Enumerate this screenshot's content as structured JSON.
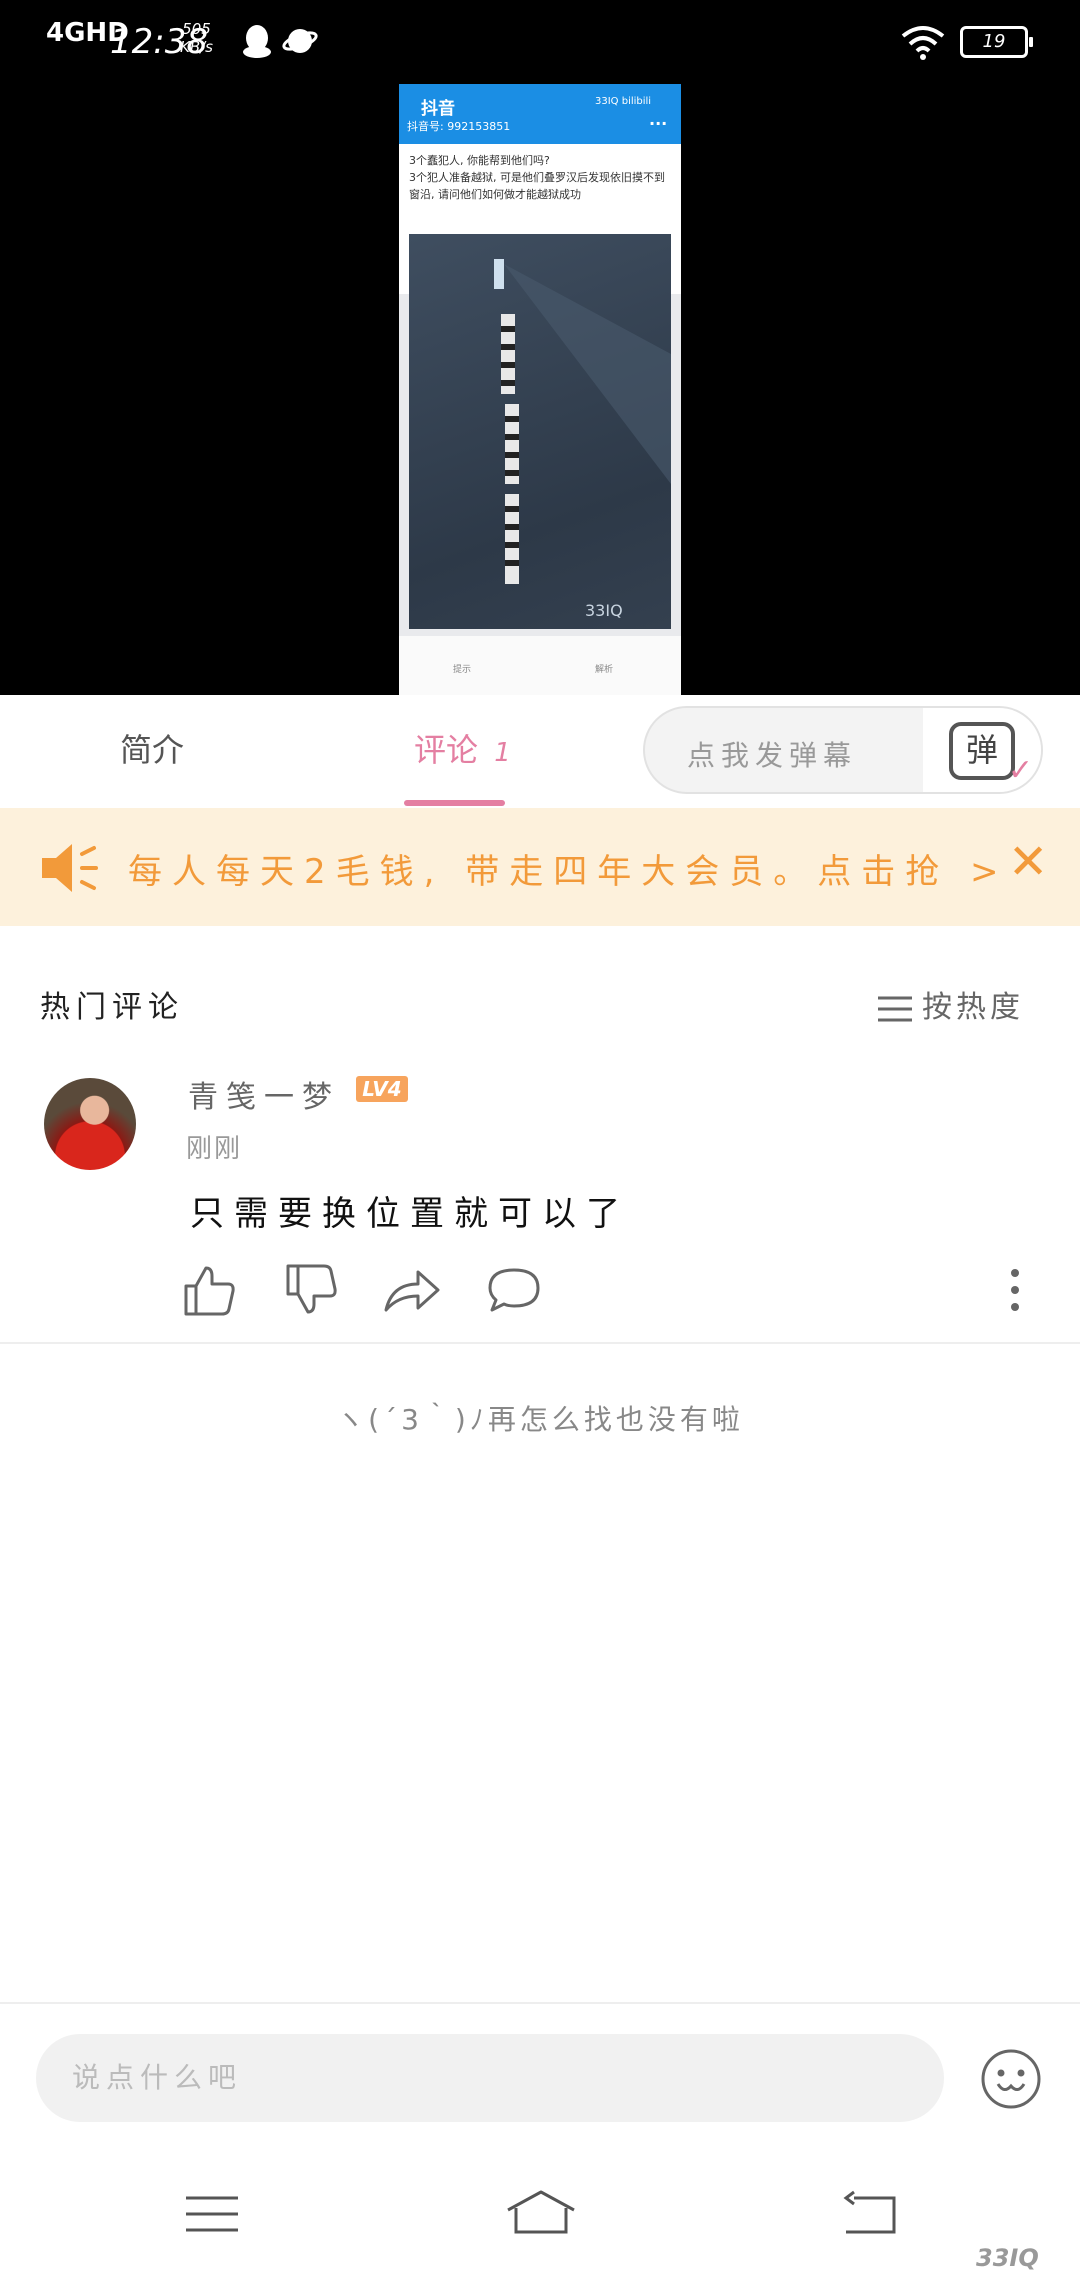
{
  "status_bar": {
    "network": "4GHD",
    "time": "12:38",
    "speed_value": "505",
    "speed_unit": "KB/s",
    "battery": "19"
  },
  "video": {
    "app_title": "抖音",
    "account_id": "抖音号: 992153851",
    "logo_text": "33IQ bilibili",
    "question_title": "3个蠢犯人, 你能帮到他们吗?",
    "question_body": "3个犯人准备越狱, 可是他们叠罗汉后发现依旧摸不到窗沿, 请问他们如何做才能越狱成功",
    "watermark": "33IQ",
    "hint_label": "提示",
    "answer_label": "解析"
  },
  "tabs": {
    "intro": "简介",
    "comments": "评论",
    "comments_count": "1"
  },
  "danmaku": {
    "placeholder": "点我发弹幕",
    "button_char": "弹"
  },
  "banner": {
    "text": "每人每天2毛钱, 带走四年大会员。点击抢 >"
  },
  "comments_section": {
    "title": "热门评论",
    "sort_label": "按热度",
    "items": [
      {
        "username": "青笺一梦",
        "level": "LV4",
        "time": "刚刚",
        "text": "只需要换位置就可以了"
      }
    ],
    "end_text": "ヽ(´3｀)ﾉ再怎么找也没有啦"
  },
  "input": {
    "placeholder": "说点什么吧"
  },
  "footer": {
    "watermark": "33IQ"
  },
  "colors": {
    "accent_pink": "#e47fa2",
    "banner_orange": "#f29a3a",
    "banner_bg": "#fdf1dc",
    "douyin_blue": "#1b8ee4"
  }
}
